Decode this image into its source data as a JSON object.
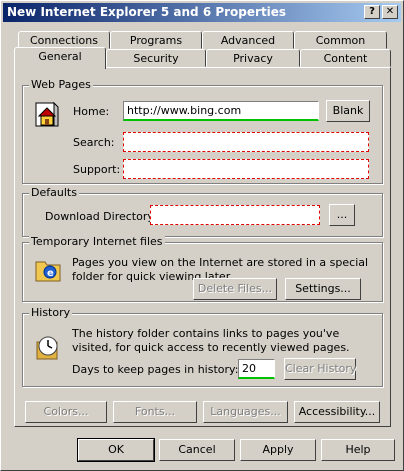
{
  "window": {
    "title": "New Internet Explorer 5 and 6 Properties",
    "help_glyph": "?",
    "close_glyph": "✕"
  },
  "tabs_top": [
    "Connections",
    "Programs",
    "Advanced",
    "Common"
  ],
  "tabs_bottom": [
    "General",
    "Security",
    "Privacy",
    "Content"
  ],
  "active_tab": "General",
  "web_pages": {
    "legend": "Web Pages",
    "home_label": "Home:",
    "home_value": "http://www.bing.com",
    "blank_button": "Blank",
    "search_label": "Search:",
    "search_value": "",
    "support_label": "Support:",
    "support_value": ""
  },
  "defaults": {
    "legend": "Defaults",
    "download_label": "Download Directory:",
    "download_value": "",
    "browse_button": "..."
  },
  "temp_files": {
    "legend": "Temporary Internet files",
    "description": "Pages you view on the Internet are stored in a special folder for quick viewing later.",
    "delete_button": "Delete Files...",
    "settings_button": "Settings..."
  },
  "history": {
    "legend": "History",
    "description": "The history folder contains links to pages you've visited, for quick access to recently viewed pages.",
    "days_label": "Days to keep pages in history:",
    "days_value": "20",
    "clear_button": "Clear History"
  },
  "bottom_buttons": {
    "colors": "Colors...",
    "fonts": "Fonts...",
    "languages": "Languages...",
    "accessibility": "Accessibility..."
  },
  "dialog_buttons": {
    "ok": "OK",
    "cancel": "Cancel",
    "apply": "Apply",
    "help": "Help"
  },
  "colors": {
    "titlebar_start": "#0a246a",
    "titlebar_end": "#a6caf0",
    "face": "#d4d0c8",
    "required_border": "#e00000",
    "valid_border": "#00c000"
  }
}
